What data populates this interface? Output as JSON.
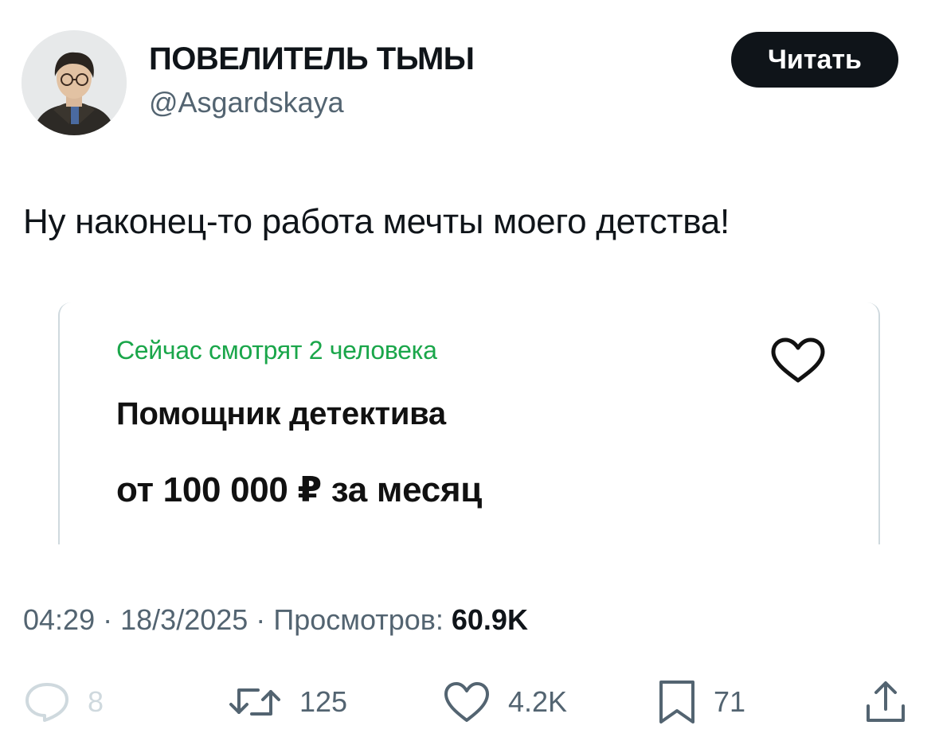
{
  "author": {
    "name": "ПОВЕЛИТЕЛЬ ТЬМЫ",
    "handle": "@Asgardskaya",
    "avatar_icon": "user-photo-avatar"
  },
  "follow_button": {
    "label": "Читать"
  },
  "tweet": {
    "text": "Ну наконец-то работа мечты моего детства!"
  },
  "card": {
    "viewers": "Сейчас смотрят 2 человека",
    "title": "Помощник детектива",
    "salary": "от 100 000 ₽ за месяц",
    "favorite_icon": "heart-outline-icon",
    "accent_color": "#1aa64a"
  },
  "meta": {
    "time": "04:29",
    "date": "18/3/2025",
    "views_label": "Просмотров:",
    "views_count": "60.9K",
    "separator": "·"
  },
  "actions": {
    "reply": {
      "icon": "reply-icon",
      "count": "8"
    },
    "retweet": {
      "icon": "retweet-icon",
      "count": "125"
    },
    "like": {
      "icon": "heart-icon",
      "count": "4.2K"
    },
    "bookmark": {
      "icon": "bookmark-icon",
      "count": "71"
    },
    "share": {
      "icon": "share-icon"
    }
  }
}
